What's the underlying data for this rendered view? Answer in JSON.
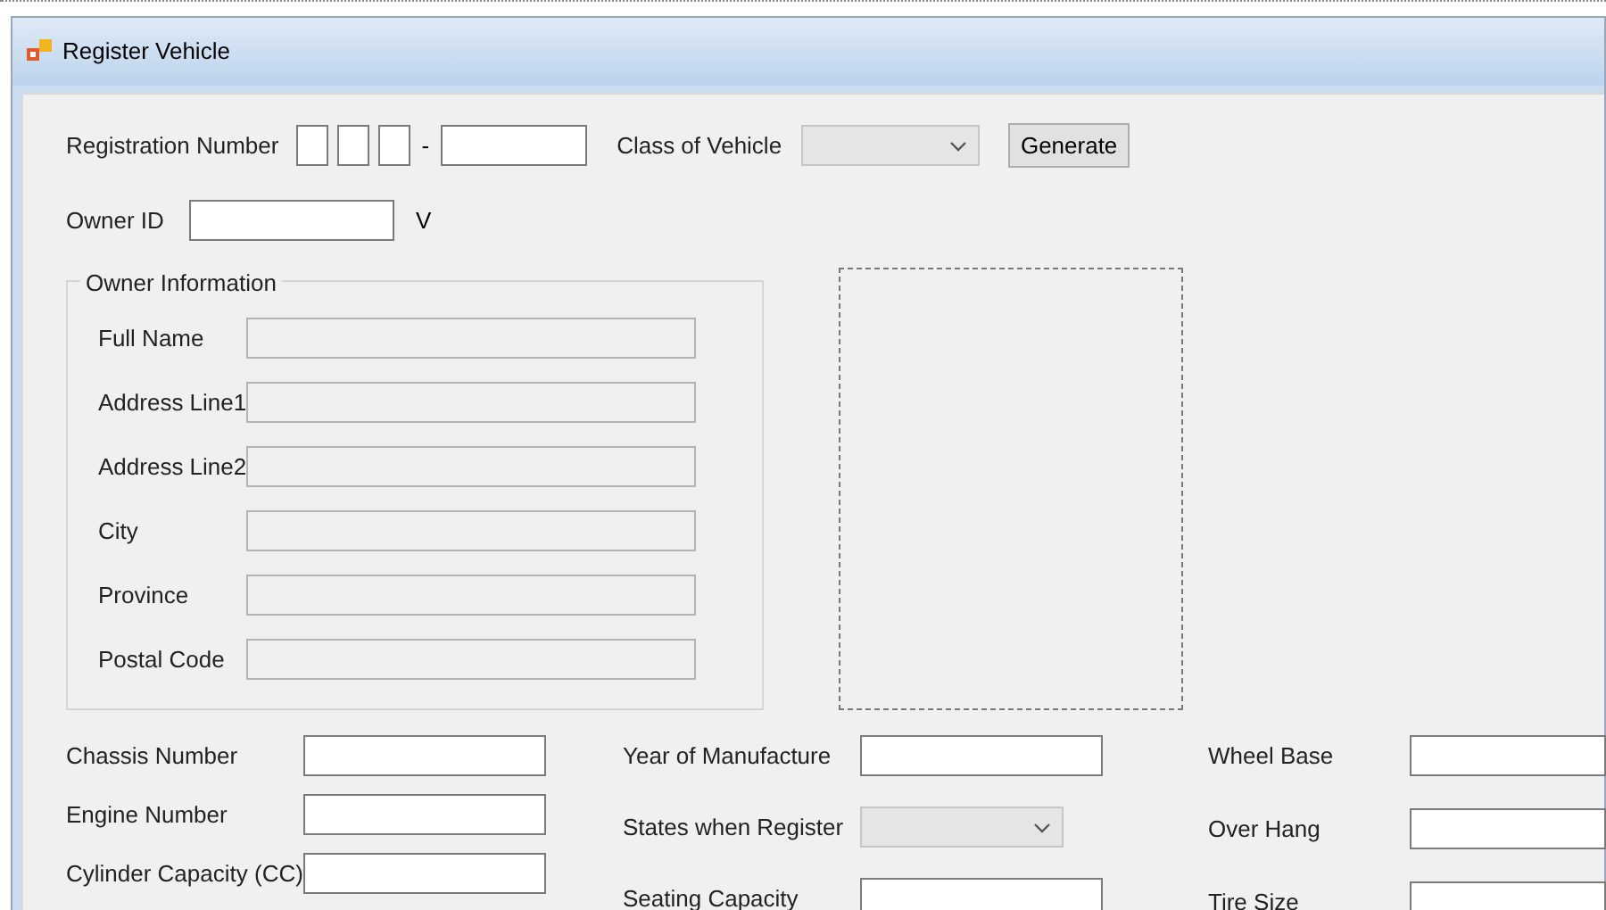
{
  "window": {
    "title": "Register Vehicle"
  },
  "registration": {
    "label": "Registration Number",
    "separator": "-"
  },
  "class_of_vehicle": {
    "label": "Class of Vehicle",
    "disabled": true
  },
  "generate_button": "Generate",
  "owner_id": {
    "label": "Owner ID",
    "suffix": "V"
  },
  "owner_information": {
    "title": "Owner Information",
    "fields": [
      {
        "label": "Full Name",
        "disabled": true
      },
      {
        "label": "Address Line1",
        "disabled": true
      },
      {
        "label": "Address Line2",
        "disabled": true
      },
      {
        "label": "City",
        "disabled": true
      },
      {
        "label": "Province",
        "disabled": true
      },
      {
        "label": "Postal Code",
        "disabled": true
      }
    ]
  },
  "vehicle_columns": [
    [
      {
        "label": "Chassis Number",
        "kind": "text"
      },
      {
        "label": "Engine Number",
        "kind": "text"
      },
      {
        "label": "Cylinder Capacity (CC)",
        "kind": "text"
      }
    ],
    [
      {
        "label": "Year of Manufacture",
        "kind": "text"
      },
      {
        "label": "States when Register",
        "kind": "combo",
        "disabled": true
      },
      {
        "label": "Seating Capacity",
        "kind": "text"
      }
    ],
    [
      {
        "label": "Wheel Base",
        "kind": "text"
      },
      {
        "label": "Over Hang",
        "kind": "text"
      },
      {
        "label": "Tire Size",
        "kind": "text"
      }
    ]
  ]
}
